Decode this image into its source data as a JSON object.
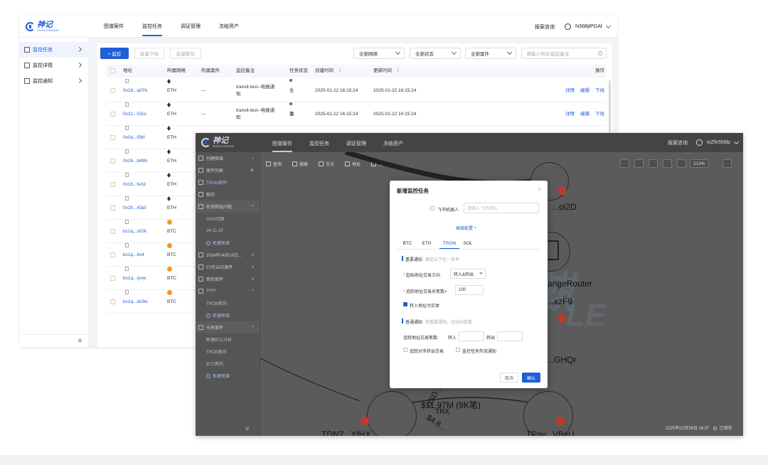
{
  "back_window": {
    "logo": {
      "cn": "神记",
      "en": "SHENJIREAN"
    },
    "nav": [
      "图谱案件",
      "监控任务",
      "调证管理",
      "冻结资产"
    ],
    "nav_active": 1,
    "report_link": "报案咨询",
    "username": "N36BjtPGAf",
    "sidebar": [
      {
        "label": "监控任务",
        "active": true
      },
      {
        "label": "监控详情",
        "active": false
      },
      {
        "label": "监控通知",
        "active": false
      }
    ],
    "collapse_glyph": "≡",
    "toolbar": {
      "add_label": "+ 监控",
      "batch_issue": "批量下线",
      "batch_delete": "批量删除",
      "network_select": "全部网络",
      "status_select": "全部状态",
      "case_select": "全部案件",
      "search_placeholder": "请输入地址/监控备注"
    },
    "columns": [
      "地址",
      "所属网络",
      "所属案件",
      "监控备注",
      "任务状态",
      "创建时间",
      "更新时间",
      "操作"
    ],
    "sort_glyph": "⇕",
    "rows": [
      {
        "address": "0x18...a07b",
        "network": "ETH",
        "case": "---",
        "remark1": "transit-test--电报通",
        "remark2": "知",
        "status": "生效",
        "created": "2025-01-22 16:15:24",
        "updated": "2025-01-22 16:15:24",
        "actions": [
          "详情",
          "编辑",
          "下线"
        ]
      },
      {
        "address": "0x32...53cc",
        "network": "ETH",
        "case": "---",
        "remark1": "transit-test--电报通",
        "remark2": "知",
        "status": "生效",
        "created": "2025-01-22 16:15:24",
        "updated": "2025-01-22 16:15:24",
        "actions": [
          "详情",
          "编辑",
          "下线"
        ]
      },
      {
        "address": "0x0a...f5bf",
        "network": "ETH",
        "case": "",
        "remark1": "",
        "remark2": "",
        "status": "",
        "created": "",
        "updated": "",
        "actions": []
      },
      {
        "address": "0x26...b49b",
        "network": "ETH",
        "case": "",
        "remark1": "",
        "remark2": "",
        "status": "",
        "created": "",
        "updated": "",
        "actions": []
      },
      {
        "address": "0x15...fe32",
        "network": "ETH",
        "case": "",
        "remark1": "",
        "remark2": "",
        "status": "",
        "created": "",
        "updated": "",
        "actions": []
      },
      {
        "address": "0x25...43af",
        "network": "ETH",
        "case": "",
        "remark1": "",
        "remark2": "",
        "status": "",
        "created": "",
        "updated": "",
        "actions": []
      },
      {
        "address": "bc1q...x02k",
        "network": "BTC",
        "case": "",
        "remark1": "",
        "remark2": "",
        "status": "",
        "created": "",
        "updated": "",
        "actions": []
      },
      {
        "address": "bc1q...ltx4",
        "network": "BTC",
        "case": "",
        "remark1": "",
        "remark2": "",
        "status": "",
        "created": "",
        "updated": "",
        "actions": []
      },
      {
        "address": "bc1q...lyvw",
        "network": "BTC",
        "case": "",
        "remark1": "",
        "remark2": "",
        "status": "",
        "created": "",
        "updated": "",
        "actions": []
      },
      {
        "address": "bc1q...dc9w",
        "network": "BTC",
        "case": "",
        "remark1": "",
        "remark2": "",
        "status": "",
        "created": "",
        "updated": "",
        "actions": []
      }
    ]
  },
  "front_window": {
    "logo": {
      "cn": "神记",
      "en": "SHENJIREAN"
    },
    "nav": [
      "图谱案件",
      "监控任务",
      "调证管理",
      "冻结资产"
    ],
    "nav_active": 0,
    "report_link": "报案咨询",
    "username": "toZfe556lp",
    "sidebar": [
      {
        "label": "创建图谱",
        "type": "top",
        "arrow": "›"
      },
      {
        "label": "案件列表",
        "type": "top",
        "arrow": "⊕"
      },
      {
        "label": "TRON案例",
        "type": "top-active",
        "arrow": ""
      },
      {
        "label": "新的",
        "type": "top",
        "arrow": ""
      },
      {
        "label": "检测筛选问题",
        "type": "grp",
        "arrow": "^"
      },
      {
        "label": "2024切换",
        "type": "sub",
        "arrow": ""
      },
      {
        "label": "24-11-29",
        "type": "sub",
        "arrow": ""
      },
      {
        "label": "新建图谱",
        "type": "add",
        "arrow": ""
      },
      {
        "label": "2024年04月18日...",
        "type": "top",
        "arrow": "v"
      },
      {
        "label": "07月18日案件",
        "type": "top",
        "arrow": "v"
      },
      {
        "label": "新的案件",
        "type": "top",
        "arrow": "v"
      },
      {
        "label": "????",
        "type": "top",
        "arrow": "^"
      },
      {
        "label": "TRON新的",
        "type": "sub",
        "arrow": ""
      },
      {
        "label": "新建图谱",
        "type": "add",
        "arrow": ""
      },
      {
        "label": "分享案件",
        "type": "grp",
        "arrow": "^"
      },
      {
        "label": "新建BTC分析",
        "type": "sub",
        "arrow": ""
      },
      {
        "label": "TRON新的",
        "type": "sub",
        "arrow": ""
      },
      {
        "label": "BTC新的",
        "type": "sub",
        "arrow": ""
      },
      {
        "label": "新建图谱",
        "type": "add",
        "arrow": ""
      }
    ],
    "collapse_glyph": "≡",
    "canvas_tools": [
      "查询",
      "搜索",
      "节点",
      "地址",
      "筛选"
    ],
    "zoom": "213%",
    "graph_labels": {
      "n1": "...oi2D",
      "n2": "...angeRouter",
      "n3": "...xzF9",
      "n4": "...GHQr",
      "n5": "TDN7...YfHX",
      "n6": "TPay...VBxU",
      "edge_amount": "$11.97M (9K笔)",
      "edge_token": "TRX",
      "edge_small": "$4.8...",
      "edge_usd": "USD..."
    },
    "watermark": "麒",
    "watermark2": "LE",
    "status": "2025年02月26日 16:07",
    "saved": "已保存"
  },
  "modal": {
    "title": "新增监控任务",
    "close": "×",
    "feishu_label": "飞书机器人",
    "feishu_placeholder": "请输入飞书地址",
    "advanced": "高级配置 ^",
    "tabs": [
      "BTC",
      "ETH",
      "TRON",
      "SOL"
    ],
    "active_tab": 2,
    "important_label": "重要通知",
    "important_hint": "满足以下任一条件",
    "direction_label": "起始地址交易方向",
    "direction_value": "转入&转出",
    "count_label": "追踪地址交易总笔数>",
    "count_value": "100",
    "entity_label": "转入地址为实体",
    "normal_label": "普通通知",
    "normal_hint": "非重要通知，仅站内查看",
    "track_label": "追踪地址交易笔数:",
    "in_label": "转入",
    "out_label": "转出",
    "opp_label": "追踪对手转出交易",
    "fail_label": "监控任务失效通知",
    "cancel": "取消",
    "confirm": "确认"
  }
}
